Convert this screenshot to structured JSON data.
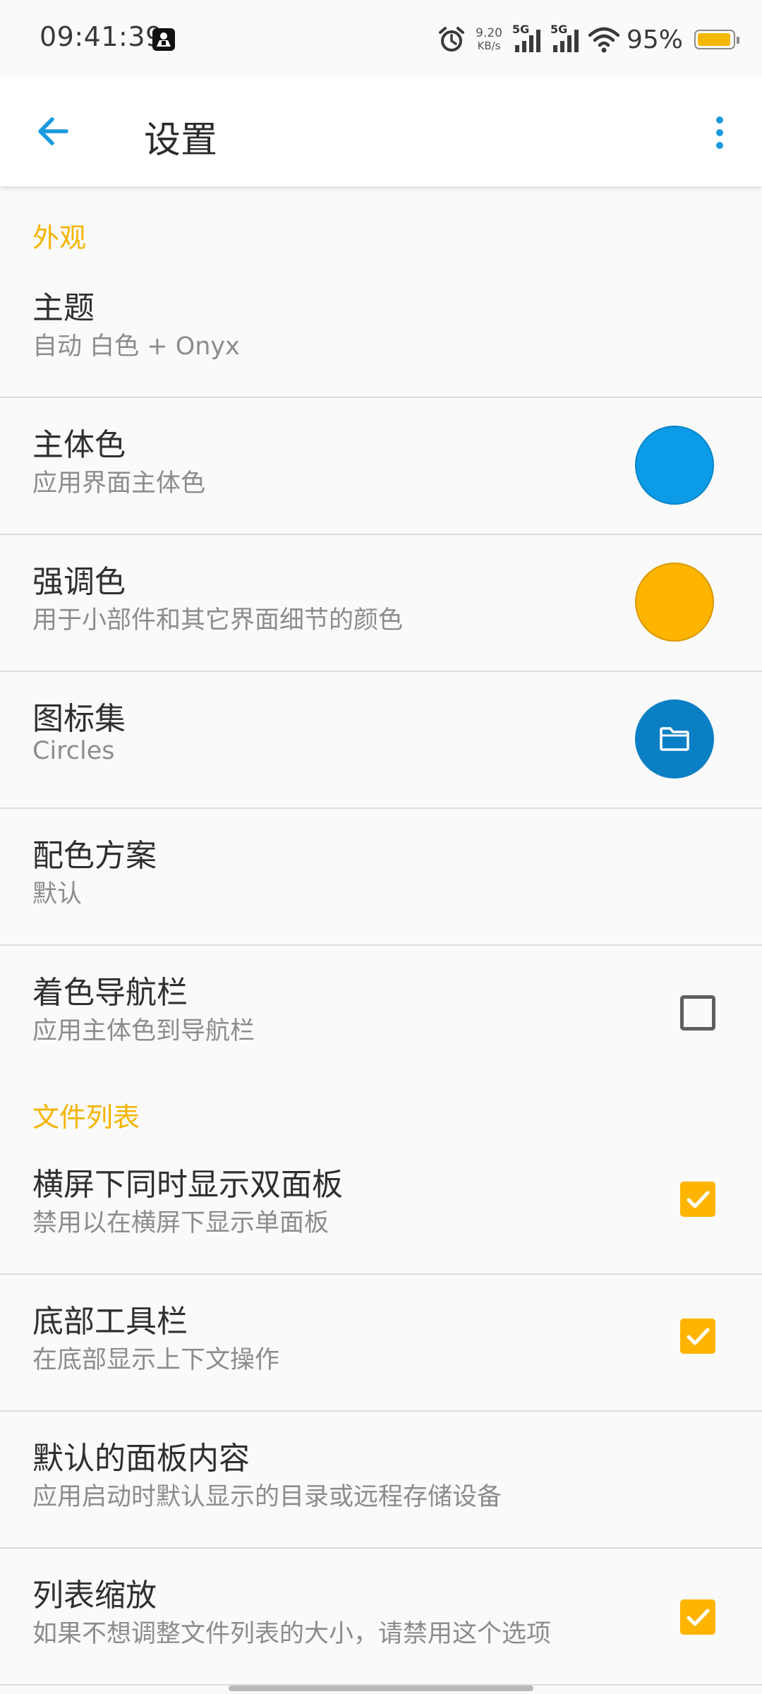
{
  "status_bar": {
    "time": "09:41:39",
    "net_speed_value": "9.20",
    "net_speed_unit": "KB/s",
    "sim1_label": "5G",
    "sim2_label": "5G",
    "battery_percent": "95%",
    "battery_level": 0.95,
    "battery_color": "#f5b800"
  },
  "appbar": {
    "title": "设置",
    "icon_color": "#1a9be0"
  },
  "colors": {
    "section_header": "#f5b400",
    "primary": "#0b9be7",
    "accent": "#ffb400",
    "iconset": "#0a7fc4",
    "checkbox_on": "#ffb400"
  },
  "sections": {
    "appearance": {
      "header": "外观",
      "theme": {
        "title": "主题",
        "summary": "自动 白色 + Onyx"
      },
      "primary_color": {
        "title": "主体色",
        "summary": "应用界面主体色"
      },
      "accent_color": {
        "title": "强调色",
        "summary": "用于小部件和其它界面细节的颜色"
      },
      "icon_set": {
        "title": "图标集",
        "summary": "Circles",
        "icon": "folder-icon"
      },
      "color_scheme": {
        "title": "配色方案",
        "summary": "默认"
      },
      "colored_navbar": {
        "title": "着色导航栏",
        "summary": "应用主体色到导航栏",
        "checked": false
      }
    },
    "file_list": {
      "header": "文件列表",
      "dual_pane": {
        "title": "横屏下同时显示双面板",
        "summary": "禁用以在横屏下显示单面板",
        "checked": true
      },
      "bottom_toolbar": {
        "title": "底部工具栏",
        "summary": "在底部显示上下文操作",
        "checked": true
      },
      "default_panel": {
        "title": "默认的面板内容",
        "summary": "应用启动时默认显示的目录或远程存储设备"
      },
      "list_zoom": {
        "title": "列表缩放",
        "summary": "如果不想调整文件列表的大小，请禁用这个选项",
        "checked": true
      }
    }
  }
}
